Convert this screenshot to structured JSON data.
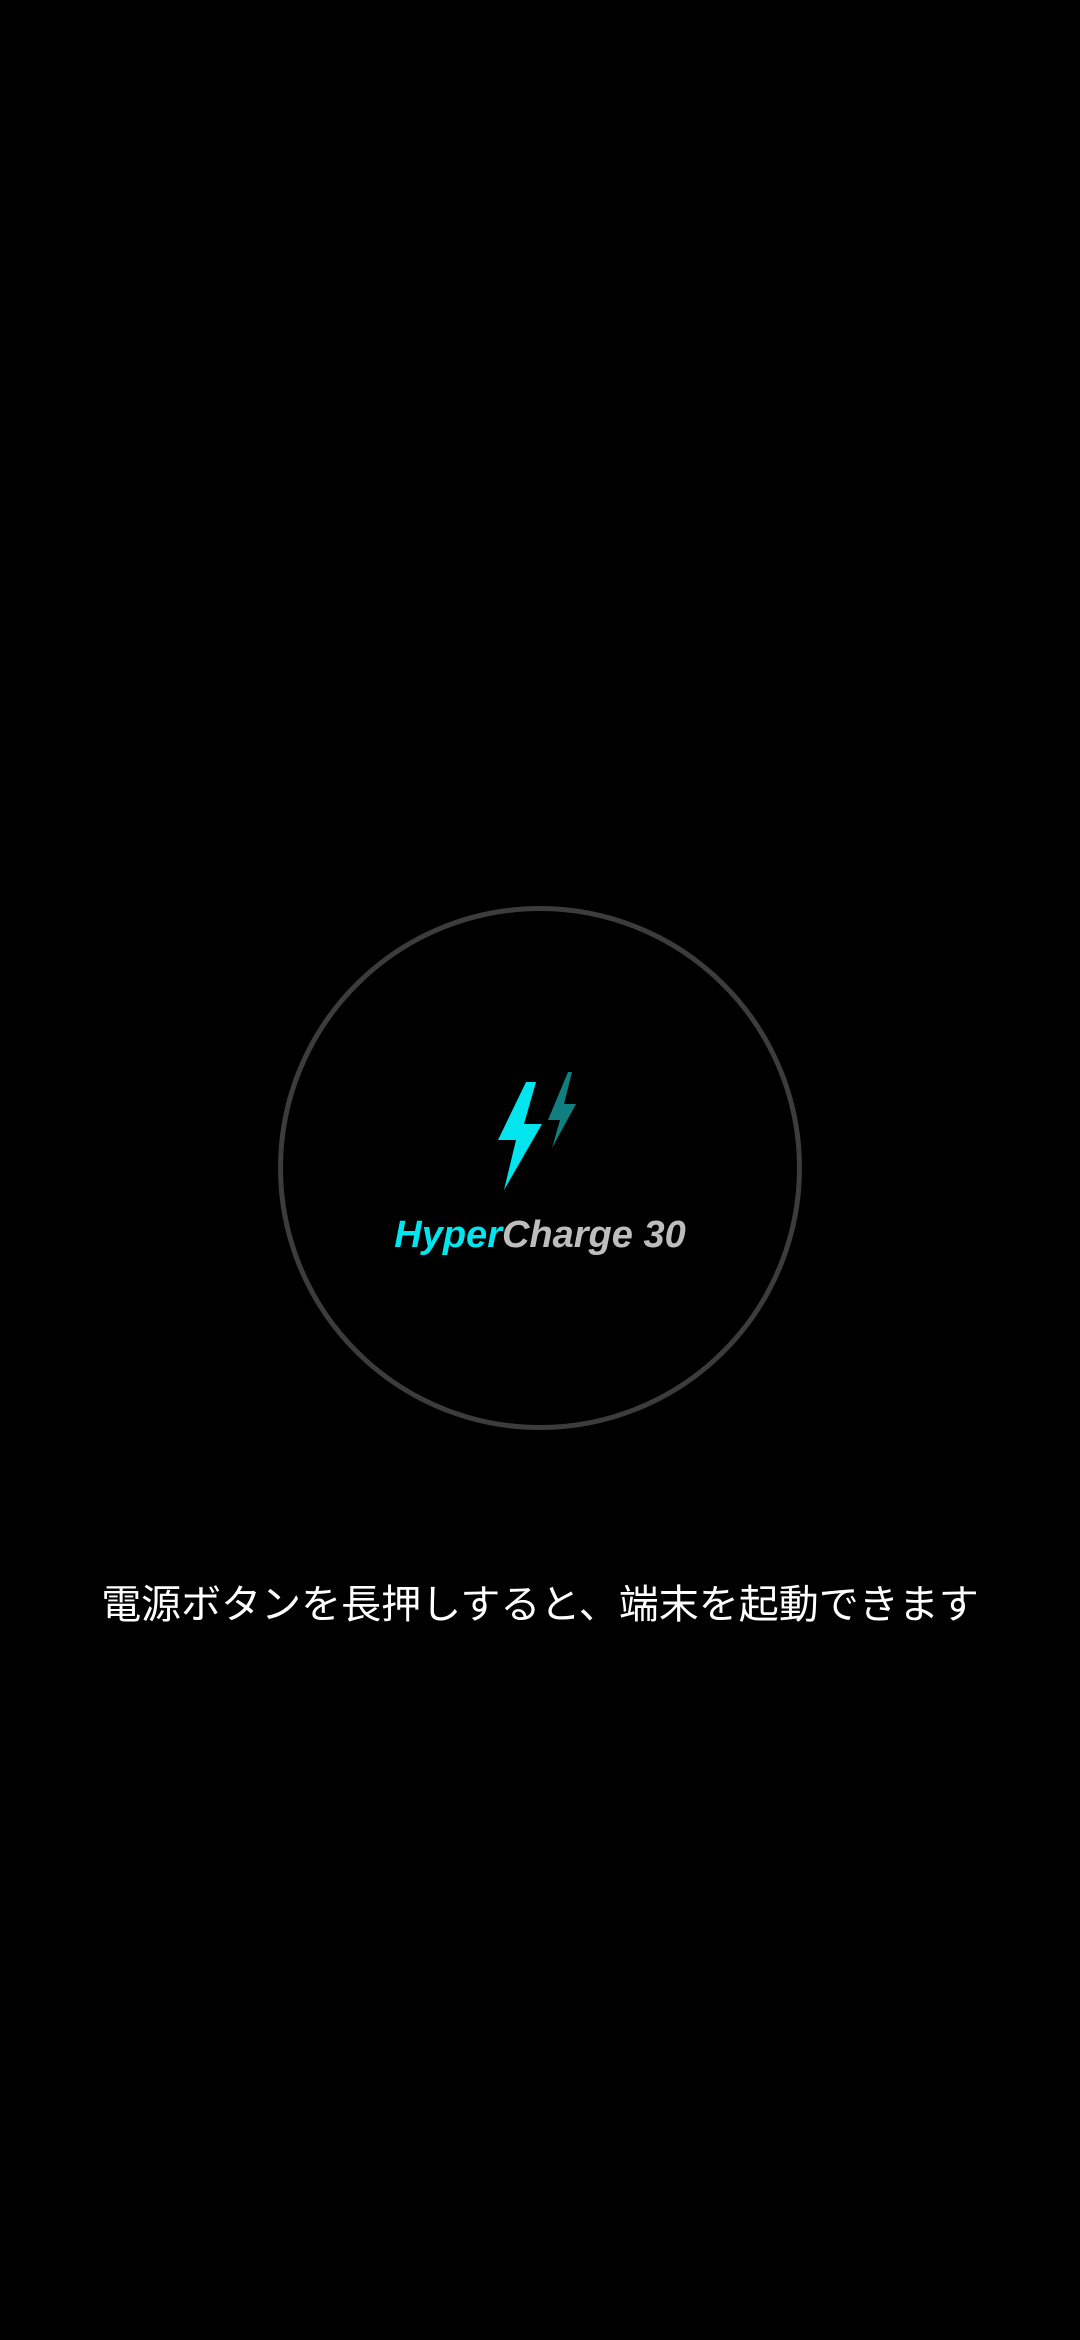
{
  "colors": {
    "background": "#000000",
    "ring": "#3c3c3c",
    "accent": "#00e5ee",
    "accent_dim": "#0f7f80",
    "brand_text": "#bdbdbd",
    "hint_text": "#ffffff"
  },
  "charge_indicator": {
    "icon": "double-lightning-bolt-icon",
    "brand_prefix": "Hyper",
    "brand_suffix": "Charge 30"
  },
  "hint": {
    "text": "電源ボタンを長押しすると、端末を起動できます"
  }
}
